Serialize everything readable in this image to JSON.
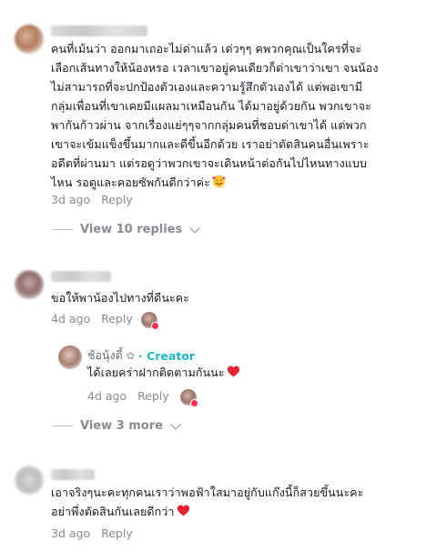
{
  "comments": [
    {
      "text_lines": [
        "คนที่เม้นว่า ออกมาเถอะไม่ด่าแล้ว เด่วๆๆ คพวกคุณเป็นใครที่จะ",
        "เลือกเส้นทางให้น้องหรอ เวลาเขาอยู่คนเดียวก็ด่าเขาว่าเขา จนน้อง",
        "ไม่สามารถที่จะปกป้องตัวเองและความรู้สึกตัวเองได้ แต่พอเขามี",
        "กลุ่มเพื่อนที่เขาเคยมีแผลมาเหมือนกัน ได้มาอยู่ด้วยกัน พวกเขาจะ",
        "พากันก้าวผ่าน จากเรื่องแย่ๆๆจากกลุ่มคนที่ชอบด่าเขาได้ แต่พวก",
        "เขาจะเข้มแข็งขึ้นมากและดีขึ้นอีกด้วย เราอย่าตัดสินคนอื่นเพราะ",
        "อดีตที่ผ่านมา แต่รอดูว่าพวกเขาจะเดินหน้าต่อกันไปไหนทางแบบ",
        "ไหน รอดูและคอยซัพกันดีกว่าค่ะ"
      ],
      "emoji": "smiling-face-with-hearts",
      "time": "3d ago",
      "reply_label": "Reply",
      "view_replies": "View 10 replies"
    },
    {
      "text_lines": [
        "ขอให้พาน้องไปทางที่ดีนะคะ"
      ],
      "time": "4d ago",
      "reply_label": "Reply",
      "creator_reply": {
        "name": "ช้อนุ้งดี้",
        "badge": "· Creator",
        "text": "ได้เลยคร่าฝากติดตามกันนะ",
        "emoji": "red-heart",
        "time": "4d ago",
        "reply_label": "Reply"
      },
      "view_replies": "View 3 more"
    },
    {
      "text_lines": [
        "เอาจริงๆนะคะทุกคนเราว่าพอฟ้าใสมาอยู่กับแก๊งนี้ก็สวยขึ้นนะคะ",
        "อย่าพึ่งตัดสินกันเลยดีกว่า"
      ],
      "emoji": "red-heart",
      "time": "3d ago",
      "reply_label": "Reply"
    }
  ]
}
